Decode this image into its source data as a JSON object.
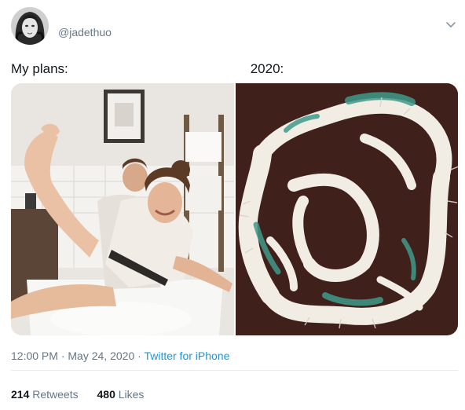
{
  "tweet": {
    "handle": "@jadethuo",
    "caption_left": "My plans:",
    "caption_right": "2020:",
    "time": "12:00 PM",
    "date": "May 24, 2020",
    "source": "Twitter for iPhone",
    "retweets_count": "214",
    "retweets_label": "Retweets",
    "likes_count": "480",
    "likes_label": "Likes"
  },
  "icons": {
    "menu": "chevron-down-icon"
  },
  "colors": {
    "link": "#1b95e0",
    "secondary_text": "#657786",
    "primary_text": "#14171a"
  }
}
